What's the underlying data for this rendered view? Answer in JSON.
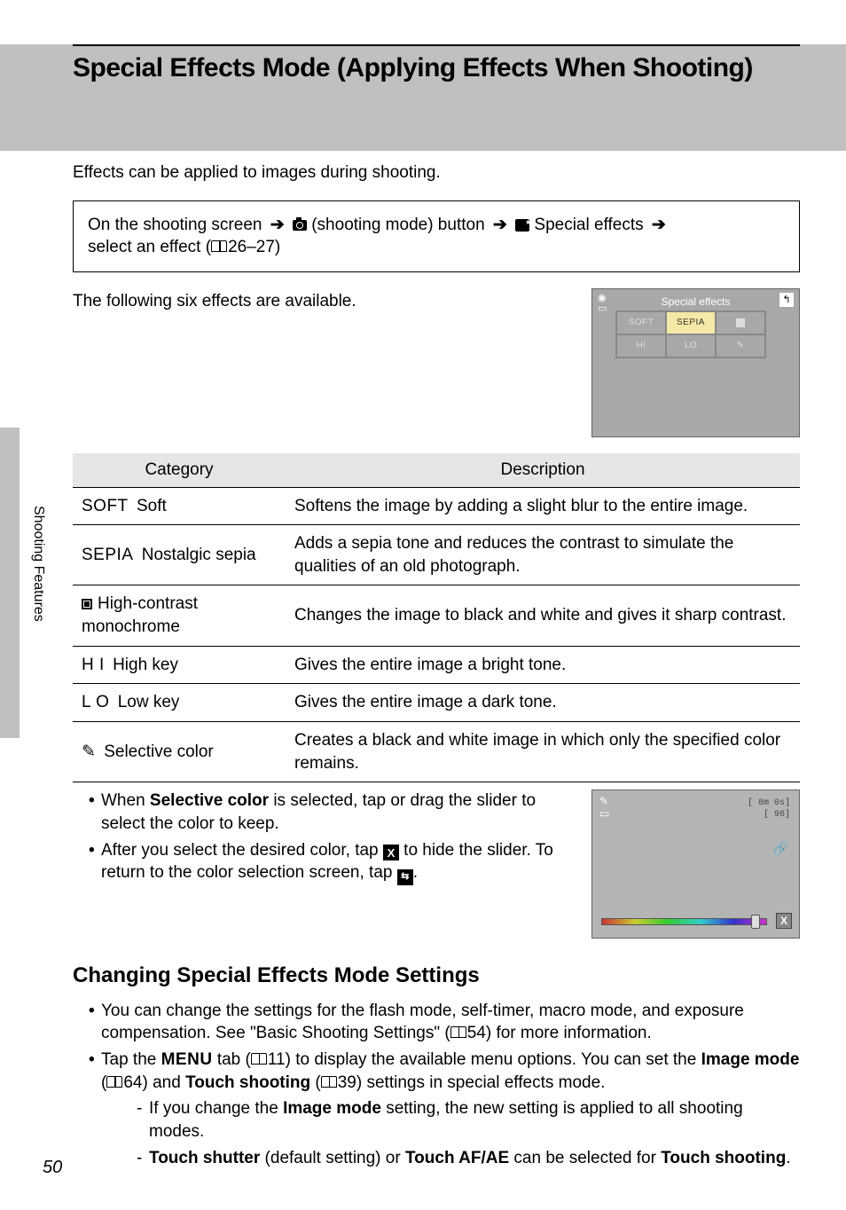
{
  "page_number": "50",
  "side_label": "Shooting Features",
  "title": "Special Effects Mode (Applying Effects When Shooting)",
  "intro": "Effects can be applied to images during shooting.",
  "nav": {
    "line1_a": "On the shooting screen",
    "line1_b": "(shooting mode) button",
    "line1_c": "Special effects",
    "line2": "select an effect (",
    "ref": "26–27",
    "line2_end": ")"
  },
  "available_text": "The following six effects are available.",
  "preview1": {
    "title": "Special effects",
    "cells": [
      "SOFT",
      "SEPIA",
      "",
      "HI",
      "LO",
      ""
    ]
  },
  "table": {
    "headers": [
      "Category",
      "Description"
    ],
    "rows": [
      {
        "code": "SOFT",
        "name": "Soft",
        "desc": "Softens the image by adding a slight blur to the entire image."
      },
      {
        "code": "SEPIA",
        "name": "Nostalgic sepia",
        "desc": "Adds a sepia tone and reduces the contrast to simulate the qualities of an old photograph."
      },
      {
        "code": "HCM",
        "name": "High-contrast monochrome",
        "desc": "Changes the image to black and white and gives it sharp contrast."
      },
      {
        "code": "HI",
        "name": "High key",
        "desc": "Gives the entire image a bright tone."
      },
      {
        "code": "LO",
        "name": "Low key",
        "desc": "Gives the entire image a dark tone."
      },
      {
        "code": "SC",
        "name": "Selective color",
        "desc": "Creates a black and white image in which only the specified color remains."
      }
    ]
  },
  "sel_bullets": {
    "b1a": "When ",
    "b1b": "Selective color",
    "b1c": " is selected, tap or drag the slider to select the color to keep.",
    "b2a": "After you select the desired color, tap ",
    "b2b": " to hide the slider. To return to the color selection screen, tap ",
    "b2c": "."
  },
  "preview2": {
    "tr1": "[   8m 0s]",
    "tr2": "[    96]"
  },
  "h2": "Changing Special Effects Mode Settings",
  "change_bullets": {
    "b1a": "You can change the settings for the flash mode, self-timer, macro mode, and exposure compensation. See \"Basic Shooting Settings\" (",
    "b1_ref": "54",
    "b1b": ") for more information.",
    "b2a": "Tap the ",
    "b2_menu": "MENU",
    "b2b": " tab (",
    "b2_ref1": "11",
    "b2c": ") to display the available menu options. You can set the ",
    "b2_im": "Image mode",
    "b2d": " (",
    "b2_ref2": "64",
    "b2e": ") and ",
    "b2_ts": "Touch shooting",
    "b2f": " (",
    "b2_ref3": "39",
    "b2g": ") settings in special effects mode.",
    "sub1a": "If you change the ",
    "sub1b": "Image mode",
    "sub1c": " setting, the new setting is applied to all shooting modes.",
    "sub2a": "Touch shutter",
    "sub2b": " (default setting) or ",
    "sub2c": "Touch AF/AE",
    "sub2d": " can be selected for ",
    "sub2e": "Touch shooting",
    "sub2f": "."
  }
}
